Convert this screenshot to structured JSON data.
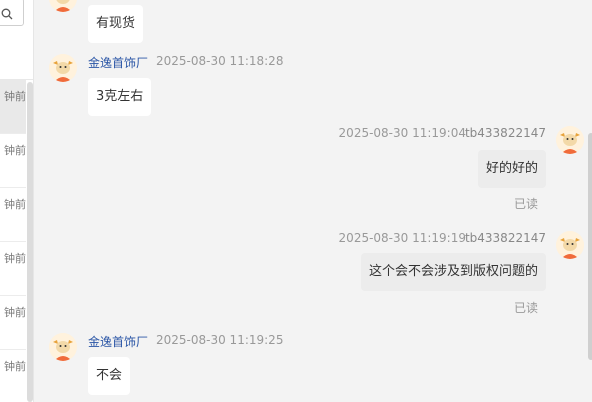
{
  "conversation_list": {
    "items": [
      {
        "time": "钟前"
      },
      {
        "time": "钟前"
      },
      {
        "time": "钟前"
      },
      {
        "time": "钟前"
      },
      {
        "time": "钟前"
      },
      {
        "time": "钟前"
      }
    ]
  },
  "messages": [
    {
      "text": "有现货"
    },
    {
      "sender": "金逸首饰厂",
      "time": "2025-08-30 11:18:28",
      "text": "3克左右"
    },
    {
      "sender": "tb433822147",
      "time": "2025-08-30 11:19:04",
      "text": "好的好的",
      "status": "已读"
    },
    {
      "sender": "tb433822147",
      "time": "2025-08-30 11:19:19",
      "text": "这个会不会涉及到版权问题的",
      "status": "已读"
    },
    {
      "sender": "金逸首饰厂",
      "time": "2025-08-30 11:19:25",
      "text": "不会"
    }
  ],
  "icons": {
    "search": "search-icon",
    "avatar": "cartoon-cow-avatar-icon"
  },
  "colors": {
    "sender_name": "#2b56a6",
    "incoming_bubble": "#ffffff",
    "outgoing_bubble": "#ececec",
    "background": "#f3f3f3",
    "avatar_accent": "#f06b3b"
  }
}
